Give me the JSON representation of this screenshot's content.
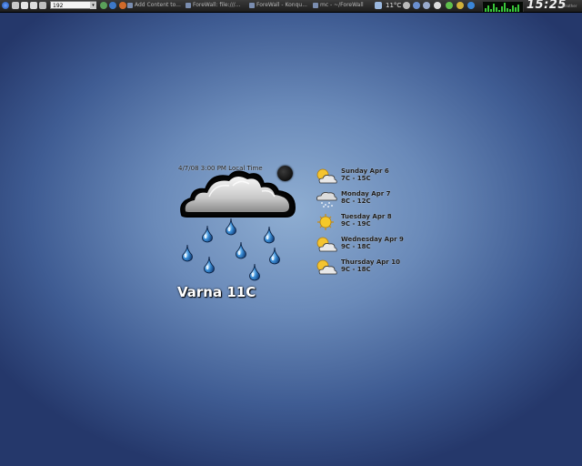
{
  "panel": {
    "url_value": "192",
    "tasks": [
      "Add Content to...",
      "ForeWall: file:///...",
      "ForeWall - Konqu...",
      "mc - ~/ForeWall"
    ],
    "temperature": "11°C",
    "clock": "15:25",
    "clock_sub": "weather"
  },
  "weather": {
    "local_time": "4/7/08 3:00 PM Local Time",
    "location_label": "Varna 11C",
    "current_condition_icon": "rain-cloud-icon",
    "forecast": [
      {
        "day": "Sunday Apr 6",
        "temp": "7C - 15C",
        "icon": "partly-cloudy-icon"
      },
      {
        "day": "Monday Apr 7",
        "temp": "8C - 12C",
        "icon": "snow-cloud-icon"
      },
      {
        "day": "Tuesday Apr 8",
        "temp": "9C - 19C",
        "icon": "sun-icon"
      },
      {
        "day": "Wednesday Apr 9",
        "temp": "9C - 18C",
        "icon": "partly-cloudy-icon"
      },
      {
        "day": "Thursday Apr 10",
        "temp": "9C - 18C",
        "icon": "partly-cloudy-icon"
      }
    ]
  },
  "colors": {
    "background_center": "#8faed2",
    "background_edge": "#25386b",
    "panel": "#2a2a2a",
    "cpu_graph": "#39c739"
  }
}
